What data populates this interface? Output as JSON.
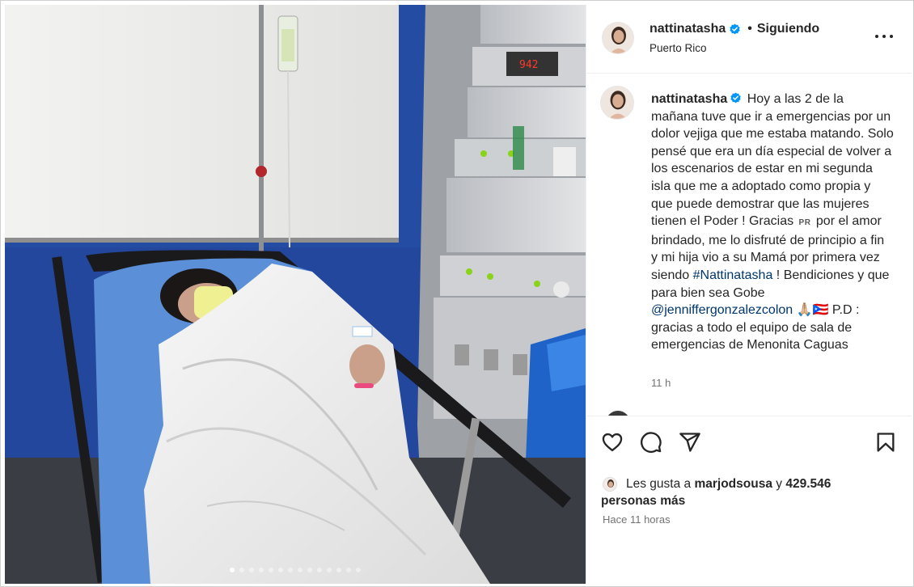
{
  "post": {
    "username": "nattinatasha",
    "follow_separator": "•",
    "follow_status": "Siguiendo",
    "location": "Puerto Rico",
    "caption": {
      "username": "nattinatasha",
      "text_part1": "Hoy a las 2 de la mañana tuve que ir a emergencias por un dolor vejiga que me estaba matando. Solo pensé que era un día especial de volver a los escenarios de estar en mi segunda isla que me a adoptado como propia y que puede demostrar que las mujeres tienen el Poder ! Gracias",
      "flag_text": "PR",
      "text_part2": "por el amor brindado, me lo disfruté de principio a fin y mi hija vio a su Mamá por primera vez siendo",
      "hashtag": "#Nattinatasha",
      "text_part3": "! Bendiciones y que para bien sea Gobe",
      "mention": "@jenniffergonzalezcolon",
      "emoji": "🙏🏼🇵🇷",
      "text_part4": "P.D : gracias a todo el equipo de sala de emergencias de Menonita Caguas"
    },
    "caption_time": "11 h",
    "likes": {
      "prefix": "Les gusta a",
      "user": "marjodsousa",
      "joiner": "y",
      "count": "429.546",
      "suffix": "personas más"
    },
    "posted_ago": "Hace 11 horas",
    "icons": {
      "like": "heart-outline-icon",
      "comment": "speech-bubble-icon",
      "share": "paper-plane-icon",
      "save": "bookmark-icon",
      "more": "more-options-icon",
      "verified": "verified-badge-icon"
    },
    "carousel": {
      "count": 14,
      "active_index": 0
    },
    "colors": {
      "link": "#00376b",
      "verified": "#0095f6",
      "muted": "#737373"
    }
  }
}
